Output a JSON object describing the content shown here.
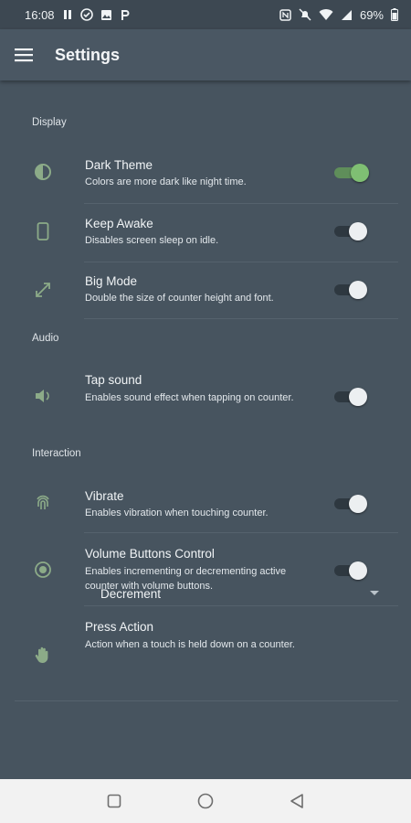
{
  "status_bar": {
    "time": "16:08",
    "battery": "69%"
  },
  "app_bar": {
    "title": "Settings"
  },
  "sections": {
    "display": "Display",
    "audio": "Audio",
    "interaction": "Interaction"
  },
  "settings": {
    "dark_theme": {
      "title": "Dark Theme",
      "subtitle": "Colors are more dark like night time.",
      "enabled": true,
      "icon": "contrast-icon"
    },
    "keep_awake": {
      "title": "Keep Awake",
      "subtitle": "Disables screen sleep on idle.",
      "enabled": false,
      "icon": "phone-icon"
    },
    "big_mode": {
      "title": "Big Mode",
      "subtitle": "Double the size of counter height and font.",
      "enabled": false,
      "icon": "expand-arrows-icon"
    },
    "tap_sound": {
      "title": "Tap sound",
      "subtitle": "Enables sound effect when tapping on counter.",
      "enabled": false,
      "icon": "volume-icon"
    },
    "vibrate": {
      "title": "Vibrate",
      "subtitle": "Enables vibration when touching counter.",
      "enabled": false,
      "icon": "fingerprint-icon"
    },
    "volume_buttons": {
      "title": "Volume Buttons Control",
      "subtitle": "Enables incrementing or decrementing active counter with volume buttons.",
      "enabled": false,
      "icon": "radio-button-icon"
    },
    "press_action": {
      "title": "Press Action",
      "subtitle": "Action when a touch is held down on a counter.",
      "value": "Decrement",
      "icon": "hand-icon"
    }
  },
  "colors": {
    "background": "#47545f",
    "app_bar": "#4a5763",
    "accent_green": "#7fbf73",
    "icon_green": "#8cab88"
  }
}
